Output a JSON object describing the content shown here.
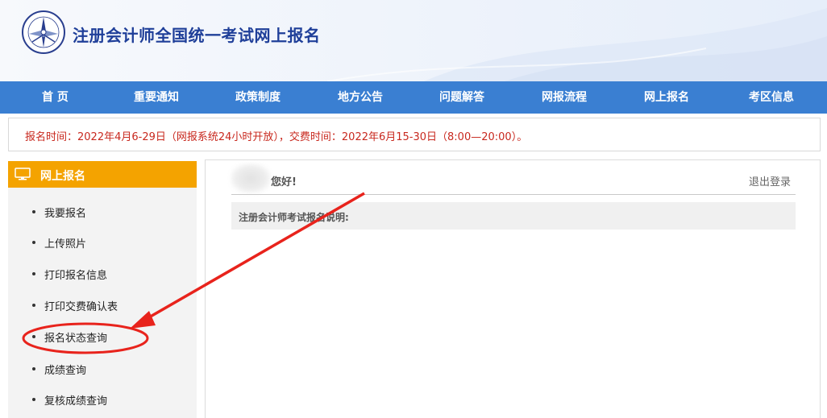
{
  "header": {
    "title": "注册会计师全国统一考试网上报名",
    "logo_icon": "cicpa-emblem-icon"
  },
  "nav": {
    "items": [
      {
        "label": "首 页"
      },
      {
        "label": "重要通知"
      },
      {
        "label": "政策制度"
      },
      {
        "label": "地方公告"
      },
      {
        "label": "问题解答"
      },
      {
        "label": "网报流程"
      },
      {
        "label": "网上报名"
      },
      {
        "label": "考区信息"
      }
    ]
  },
  "notice": {
    "text": "报名时间：2022年4月6-29日（网报系统24小时开放），交费时间：2022年6月15-30日（8:00—20:00）。"
  },
  "sidebar": {
    "header_label": "网上报名",
    "header_icon": "monitor-icon",
    "items": [
      {
        "label": "我要报名"
      },
      {
        "label": "上传照片"
      },
      {
        "label": "打印报名信息"
      },
      {
        "label": "打印交费确认表"
      },
      {
        "label": "报名状态查询",
        "highlighted": true
      },
      {
        "label": "成绩查询"
      },
      {
        "label": "复核成绩查询"
      }
    ]
  },
  "main": {
    "greeting": "您好!",
    "logout_label": "退出登录",
    "instructions_title": "注册会计师考试报名说明:"
  },
  "colors": {
    "nav_bg": "#3a7fd2",
    "title_blue": "#1f3f99",
    "sidebar_header": "#f4a300",
    "notice_red": "#c8281e",
    "annotation_red": "#e8231c"
  }
}
